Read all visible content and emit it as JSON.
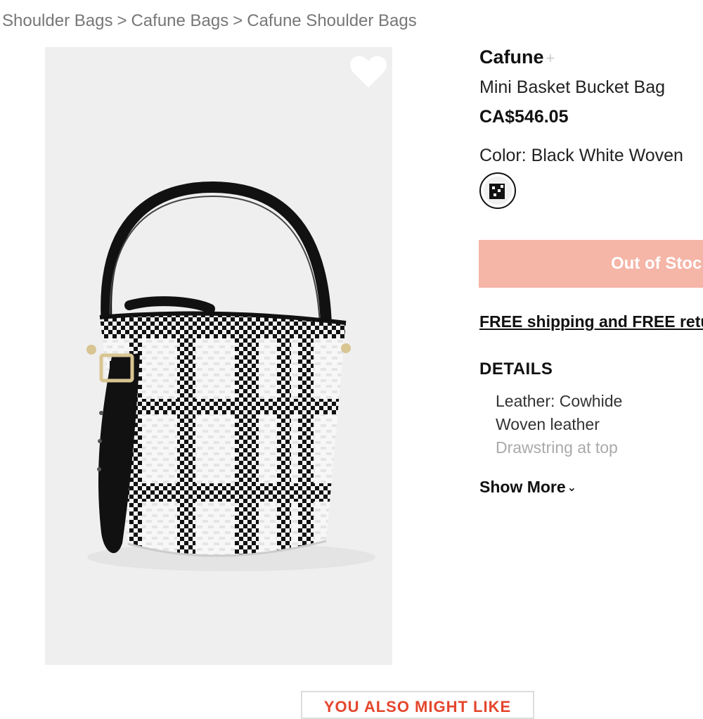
{
  "breadcrumb": {
    "items": [
      "Shoulder Bags",
      "Cafune Bags",
      "Cafune Shoulder Bags"
    ],
    "separator": ">"
  },
  "product": {
    "brand": "Cafune",
    "brand_follow": "+",
    "name": "Mini Basket Bucket Bag",
    "price": "CA$546.05",
    "color_label": "Color:",
    "color_value": "Black White Woven",
    "stock_button": "Out of Stock",
    "shipping_text": "FREE shipping and FREE returns",
    "details_heading": "DETAILS",
    "details": [
      "Leather: Cowhide",
      "Woven leather",
      "Drawstring at top"
    ],
    "show_more": "Show More"
  },
  "recommendations": {
    "heading": "YOU ALSO MIGHT LIKE"
  },
  "colors": {
    "stock_button_bg": "#f5b5a7",
    "recommendations_heading": "#e4462d"
  }
}
